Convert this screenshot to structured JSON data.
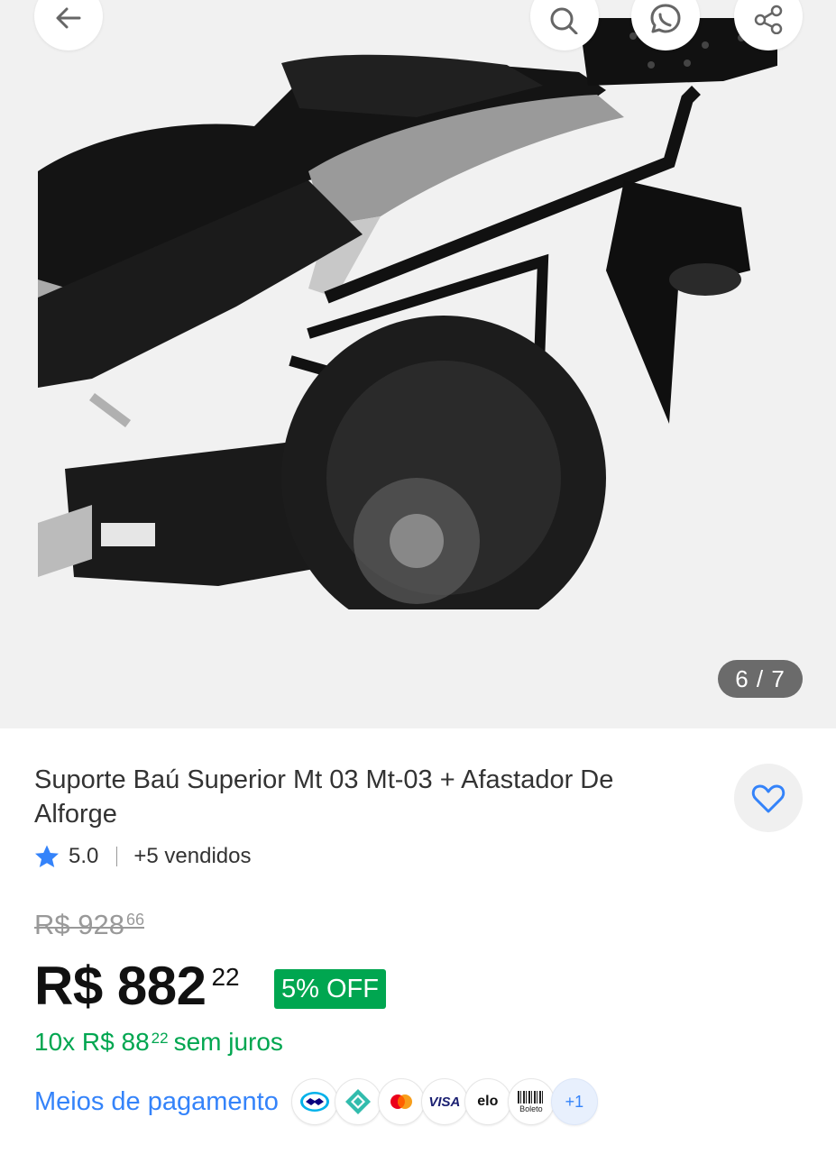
{
  "gallery": {
    "counter": "6 / 7",
    "image_alt": "Suporte baú superior e afastador de alforge montados em motocicleta"
  },
  "header_icons": {
    "back": "arrow-left-icon",
    "search": "search-icon",
    "whatsapp": "whatsapp-icon",
    "share": "share-icon"
  },
  "product": {
    "title": "Suporte Baú Superior Mt 03 Mt-03 +  Afastador De Alforge",
    "rating": "5.0",
    "sold": "+5 vendidos",
    "old_price": {
      "main": "R$ 928",
      "cents": "66"
    },
    "price": {
      "main": "R$ 882",
      "cents": "22"
    },
    "discount": "5% OFF",
    "installments": {
      "prefix": "10x R$ 88",
      "cents": "22",
      "suffix": "sem juros"
    }
  },
  "payment": {
    "link_label": "Meios de pagamento",
    "methods": [
      "mercado-pago",
      "pix",
      "mastercard",
      "VISA",
      "elo",
      "Boleto"
    ],
    "more": "+1"
  },
  "colors": {
    "accent_blue": "#3483fa",
    "green": "#00a650",
    "gallery_bg": "#f1f1f1",
    "counter_bg": "#6b6b6b"
  }
}
